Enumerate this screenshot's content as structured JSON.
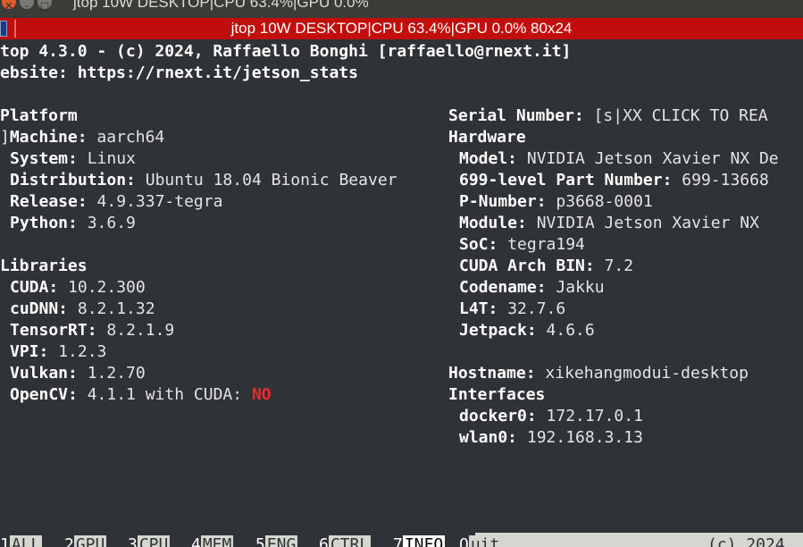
{
  "window": {
    "title": "jtop 10W DESKTOP|CPU 63.4%|GPU 0.0%",
    "tab_title": "jtop 10W DESKTOP|CPU 63.4%|GPU 0.0% 80x24"
  },
  "header": {
    "line1": "top 4.3.0 - (c) 2024, Raffaello Bonghi [raffaello@rnext.it]",
    "line2": "ebsite: https://rnext.it/jetson_stats"
  },
  "platform": {
    "title": "Platform",
    "machine_prefix": "]",
    "machine_label": "Machine:",
    "machine": "aarch64",
    "system_label": "System:",
    "system": "Linux",
    "distribution_label": "Distribution:",
    "distribution": "Ubuntu 18.04 Bionic Beaver",
    "release_label": "Release:",
    "release": "4.9.337-tegra",
    "python_label": "Python:",
    "python": "3.6.9"
  },
  "libraries": {
    "title": "Libraries",
    "cuda_label": "CUDA:",
    "cuda": "10.2.300",
    "cudnn_label": "cuDNN:",
    "cudnn": "8.2.1.32",
    "tensorrt_label": "TensorRT:",
    "tensorrt": "8.2.1.9",
    "vpi_label": "VPI:",
    "vpi": "1.2.3",
    "vulkan_label": "Vulkan:",
    "vulkan": "1.2.70",
    "opencv_label": "OpenCV:",
    "opencv": "4.1.1 with CUDA:",
    "opencv_cuda": "NO"
  },
  "serial": {
    "label": "Serial Number:",
    "value": "[s|XX CLICK TO REA"
  },
  "hardware": {
    "title": "Hardware",
    "model_label": "Model:",
    "model": "NVIDIA Jetson Xavier NX De",
    "part_label": "699-level Part Number:",
    "part": "699-13668",
    "pnumber_label": "P-Number:",
    "pnumber": "p3668-0001",
    "module_label": "Module:",
    "module": "NVIDIA Jetson Xavier NX",
    "soc_label": "SoC:",
    "soc": "tegra194",
    "cuda_arch_label": "CUDA Arch BIN:",
    "cuda_arch": "7.2",
    "codename_label": "Codename:",
    "codename": "Jakku",
    "l4t_label": "L4T:",
    "l4t": "32.7.6",
    "jetpack_label": "Jetpack:",
    "jetpack": "4.6.6"
  },
  "network": {
    "hostname_label": "Hostname:",
    "hostname": "xikehangmodui-desktop",
    "interfaces_title": "Interfaces",
    "docker0_label": "docker0:",
    "docker0": "172.17.0.1",
    "wlan0_label": "wlan0:",
    "wlan0": "192.168.3.13"
  },
  "menu": {
    "items": [
      {
        "key": "1",
        "label": "ALL"
      },
      {
        "key": "2",
        "label": "GPU"
      },
      {
        "key": "3",
        "label": "CPU"
      },
      {
        "key": "4",
        "label": "MEM"
      },
      {
        "key": "5",
        "label": "ENG"
      },
      {
        "key": "6",
        "label": "CTRL"
      },
      {
        "key": "7",
        "label": "INFO"
      },
      {
        "key": "Q",
        "label": "uit"
      }
    ],
    "copyright": "(c) 2024"
  },
  "colors": {
    "tab_bar": "#c20d0d",
    "terminal_bg": "#2f3236",
    "warning": "#ef2929"
  }
}
